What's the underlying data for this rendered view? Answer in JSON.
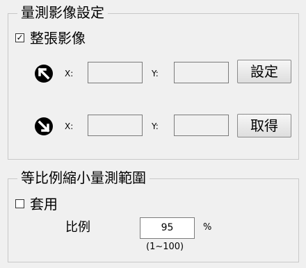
{
  "measure_group": {
    "title": "量測影像設定",
    "whole_image_checkbox": {
      "label": "整張影像",
      "checked": true,
      "mark": "✓"
    },
    "top_left_row": {
      "icon": "arrow-up-left-icon",
      "x_label": "X:",
      "y_label": "Y:",
      "x_value": "",
      "y_value": "",
      "button_label": "設定"
    },
    "bottom_right_row": {
      "icon": "arrow-down-right-icon",
      "x_label": "X:",
      "y_label": "Y:",
      "x_value": "",
      "y_value": "",
      "button_label": "取得"
    }
  },
  "scale_group": {
    "title": "等比例縮小量測範圍",
    "apply_checkbox": {
      "label": "套用",
      "checked": false
    },
    "ratio_label": "比例",
    "ratio_value": "95",
    "ratio_unit": "%",
    "ratio_hint": "(1~100)"
  }
}
